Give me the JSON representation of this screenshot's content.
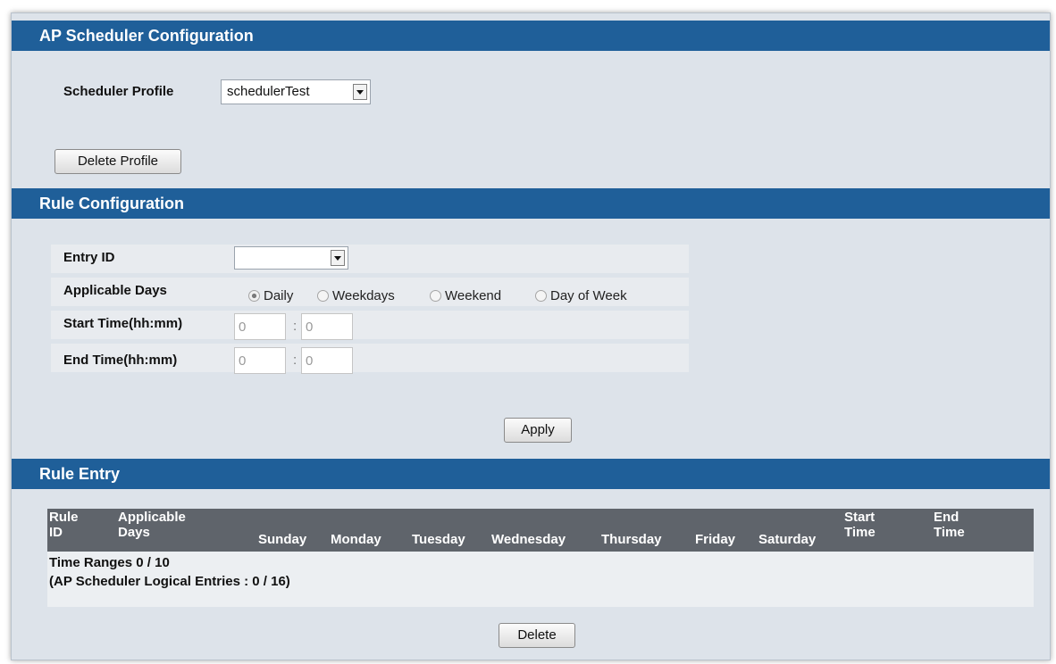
{
  "ap_scheduler": {
    "title": "AP Scheduler Configuration",
    "profile_label": "Scheduler Profile",
    "profile_value": "schedulerTest",
    "delete_profile_label": "Delete Profile"
  },
  "rule_config": {
    "title": "Rule Configuration",
    "entry_id_label": "Entry ID",
    "entry_id_value": "",
    "applicable_days_label": "Applicable Days",
    "options": [
      "Daily",
      "Weekdays",
      "Weekend",
      "Day of Week"
    ],
    "selected_option": "Daily",
    "start_time_label": "Start Time(hh:mm)",
    "end_time_label": "End Time(hh:mm)",
    "time_separator": ":",
    "start_hh": "0",
    "start_mm": "0",
    "end_hh": "0",
    "end_mm": "0",
    "apply_label": "Apply"
  },
  "rule_entry": {
    "title": "Rule Entry",
    "columns": [
      [
        "Rule",
        "ID"
      ],
      [
        "Applicable",
        "Days"
      ],
      [
        "",
        "Sunday"
      ],
      [
        "",
        "Monday"
      ],
      [
        "",
        "Tuesday"
      ],
      [
        "",
        "Wednesday"
      ],
      [
        "",
        "Thursday"
      ],
      [
        "",
        "Friday"
      ],
      [
        "",
        "Saturday"
      ],
      [
        "Start",
        "Time"
      ],
      [
        "End",
        "Time"
      ]
    ],
    "time_ranges": "Time Ranges 0 / 10",
    "logical_entries": "(AP Scheduler Logical Entries : 0 / 16)",
    "delete_label": "Delete"
  }
}
